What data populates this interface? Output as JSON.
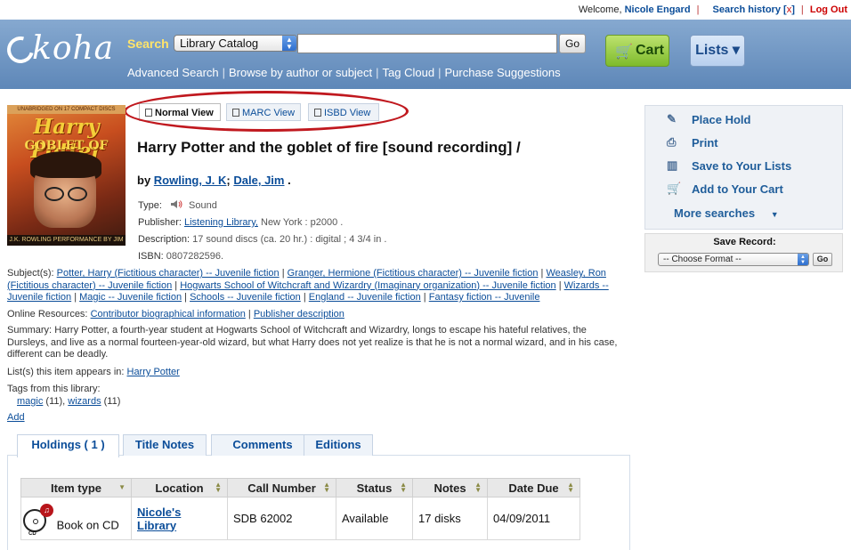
{
  "topbar": {
    "welcome": "Welcome,",
    "user_name": "Nicole Engard",
    "search_history": "Search history",
    "clear_history": "x",
    "logout": "Log Out"
  },
  "header": {
    "logo_text": "koha",
    "search_label": "Search",
    "catalog_option": "Library Catalog",
    "search_value": "",
    "go_label": "Go",
    "cart_label": "Cart",
    "lists_label": "Lists ▾",
    "links": [
      "Advanced Search",
      "Browse by author or subject",
      "Tag Cloud",
      "Purchase Suggestions"
    ]
  },
  "view_tabs": [
    "Normal View",
    "MARC View",
    "ISBD View"
  ],
  "cover": {
    "top_strip": "UNABRIDGED ON 17 COMPACT DISCS",
    "title_a": "Harry Potter",
    "title_b": "GOBLET OF FIRE",
    "bottom": "J.K. ROWLING  PERFORMANCE BY JIM DALE"
  },
  "record": {
    "title": "Harry Potter and the goblet of fire [sound recording] /",
    "by_label": "by",
    "author1": "Rowling, J. K",
    "author2": "Dale, Jim",
    "byline_sep": ";",
    "byline_end": ".",
    "type_label": "Type:",
    "type_value": "Sound",
    "publisher_label": "Publisher:",
    "publisher_link": "Listening Library,",
    "publisher_rest": "New York : p2000 .",
    "description_label": "Description:",
    "description_value": "17 sound discs (ca. 20 hr.) : digital ; 4 3/4 in .",
    "isbn_label": "ISBN:",
    "isbn_value": "0807282596."
  },
  "subjects": {
    "label": "Subject(s):",
    "items": [
      "Potter, Harry (Fictitious character) -- Juvenile fiction",
      "Granger, Hermione (Fictitious character) -- Juvenile fiction",
      "Weasley, Ron (Fictitious character) -- Juvenile fiction",
      "Hogwarts School of Witchcraft and Wizardry (Imaginary organization) -- Juvenile fiction",
      "Wizards -- Juvenile fiction",
      "Magic -- Juvenile fiction",
      "Schools -- Juvenile fiction",
      "England -- Juvenile fiction",
      "Fantasy fiction -- Juvenile"
    ]
  },
  "online_resources": {
    "label": "Online Resources:",
    "items": [
      "Contributor biographical information",
      "Publisher description"
    ]
  },
  "summary": {
    "label": "Summary:",
    "text": "Harry Potter, a fourth-year student at Hogwarts School of Witchcraft and Wizardry, longs to escape his hateful relatives, the Dursleys, and live as a normal fourteen-year-old wizard, but what Harry does not yet realize is that he is not a normal wizard, and in his case, different can be deadly."
  },
  "lists": {
    "label": "List(s) this item appears in:",
    "item": "Harry Potter"
  },
  "tags": {
    "label": "Tags from this library:",
    "items": [
      {
        "name": "magic",
        "count": "(11),"
      },
      {
        "name": "wizards",
        "count": "(11)"
      }
    ],
    "add": "Add"
  },
  "holdings_tabs": [
    "Holdings ( 1 )",
    "Title Notes",
    "Comments",
    "Editions"
  ],
  "holdings": {
    "columns": [
      "Item type",
      "Location",
      "Call Number",
      "Status",
      "Notes",
      "Date Due"
    ],
    "rows": [
      {
        "item_type": "Book on CD",
        "icon_label": "CD",
        "location": "Nicole's Library",
        "call_number": "SDB 62002",
        "status": "Available",
        "notes": "17 disks",
        "date_due": "04/09/2011"
      }
    ]
  },
  "sidebar": {
    "actions": [
      {
        "label": "Place Hold",
        "icon": "hold-icon"
      },
      {
        "label": "Print",
        "icon": "print-icon"
      },
      {
        "label": "Save to Your Lists",
        "icon": "lists-icon"
      },
      {
        "label": "Add to Your Cart",
        "icon": "cart-icon"
      }
    ],
    "more_searches": "More searches",
    "save_record": {
      "title": "Save Record:",
      "format_option": "-- Choose Format --",
      "go": "Go"
    }
  },
  "colors": {
    "header_top": "#86a9d0",
    "header_bottom": "#5e87b8",
    "link": "#0b4d99",
    "search_label": "#ffe46a",
    "cart_green": "#7ebb2c",
    "annotation_red": "#c0181e"
  }
}
